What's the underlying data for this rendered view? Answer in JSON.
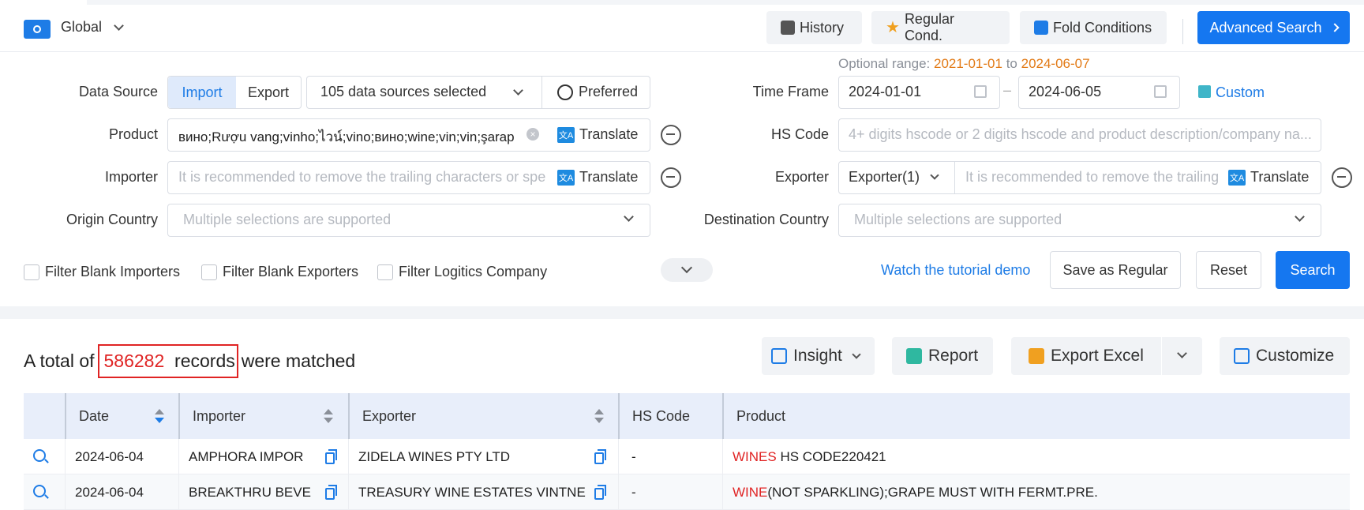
{
  "topbar": {
    "region": "Global",
    "history": "History",
    "regular_cond": "Regular Cond.",
    "fold_conditions": "Fold Conditions",
    "advanced_search": "Advanced Search"
  },
  "form": {
    "data_source_label": "Data Source",
    "import_label": "Import",
    "export_label": "Export",
    "sources_selected": "105 data sources selected",
    "preferred": "Preferred",
    "optional_range_prefix": "Optional range:",
    "optional_range_start": "2021-01-01",
    "optional_range_to": "to",
    "optional_range_end": "2024-06-07",
    "time_frame_label": "Time Frame",
    "date_from": "2024-01-01",
    "date_to": "2024-06-05",
    "date_sep": "–",
    "custom": "Custom",
    "product_label": "Product",
    "product_value": "вино;Rượu vang;vinho;ไวน์;vino;вино;wine;vin;vin;şarap",
    "translate": "Translate",
    "hs_code_label": "HS Code",
    "hs_code_placeholder": "4+ digits hscode or 2 digits hscode and product description/company na...",
    "importer_label": "Importer",
    "importer_placeholder": "It is recommended to remove the trailing characters or spe",
    "exporter_label": "Exporter",
    "exporter_select": "Exporter(1)",
    "exporter_placeholder": "It is recommended to remove the trailing",
    "origin_label": "Origin Country",
    "origin_placeholder": "Multiple selections are supported",
    "destination_label": "Destination Country",
    "destination_placeholder": "Multiple selections are supported",
    "filter_blank_importers": "Filter Blank Importers",
    "filter_blank_exporters": "Filter Blank Exporters",
    "filter_logistics": "Filter Logitics Company",
    "tutorial": "Watch the tutorial demo",
    "save_regular": "Save as Regular",
    "reset": "Reset",
    "search": "Search"
  },
  "results": {
    "prefix": "A total of",
    "count": "586282",
    "records": "records",
    "suffix": "were matched",
    "insight": "Insight",
    "report": "Report",
    "export_excel": "Export Excel",
    "customize": "Customize"
  },
  "table": {
    "columns": [
      "Date",
      "Importer",
      "Exporter",
      "HS Code",
      "Product"
    ],
    "rows": [
      {
        "date": "2024-06-04",
        "importer": "AMPHORA IMPOR",
        "exporter": "ZIDELA WINES PTY LTD",
        "hs": "-",
        "product_hl": "WINES",
        "product_rest": " HS CODE220421"
      },
      {
        "date": "2024-06-04",
        "importer": "BREAKTHRU BEVE",
        "exporter": "TREASURY WINE ESTATES VINTNE",
        "hs": "-",
        "product_hl": "WINE",
        "product_rest": "(NOT SPARKLING);GRAPE MUST WITH FERMT.PRE."
      }
    ]
  },
  "colors": {
    "primary": "#1577f0",
    "highlight": "#e02424",
    "orange": "#e27a16"
  }
}
